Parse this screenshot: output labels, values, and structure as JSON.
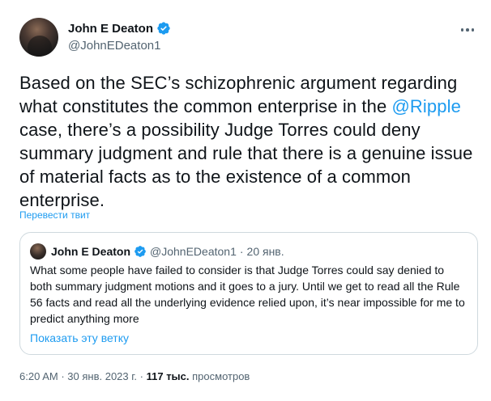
{
  "author": {
    "name": "John E Deaton",
    "handle": "@JohnEDeaton1"
  },
  "tweet": {
    "text_before": "Based on the SEC’s schizophrenic argument regarding what constitutes the common enterprise in the ",
    "mention": "@Ripple",
    "text_after": " case, there’s a possibility Judge Torres could deny summary judgment and rule that there is a genuine issue of material facts as to the existence of a common enterprise.",
    "translate_label": "Перевести твит"
  },
  "quote": {
    "name": "John E Deaton",
    "handle": "@JohnEDeaton1",
    "separator": "·",
    "date": "20 янв.",
    "text": "What some people have failed to consider is that Judge Torres could say denied to both summary judgment motions and it goes to a jury. Until we get to read all the Rule 56 facts and read all the underlying evidence relied upon, it’s near impossible for me to predict anything more",
    "show_thread": "Показать эту ветку"
  },
  "meta": {
    "time": "6:20 AM",
    "separator1": "·",
    "date": "30 янв. 2023 г.",
    "separator2": "·",
    "views_count": "117 тыс.",
    "views_label": "просмотров"
  },
  "colors": {
    "accent": "#1d9bf0",
    "text": "#0f1419",
    "secondary": "#536471",
    "border": "#cfd9de"
  },
  "icons": {
    "verified": "verified-badge-icon",
    "more": "more-options-icon"
  }
}
